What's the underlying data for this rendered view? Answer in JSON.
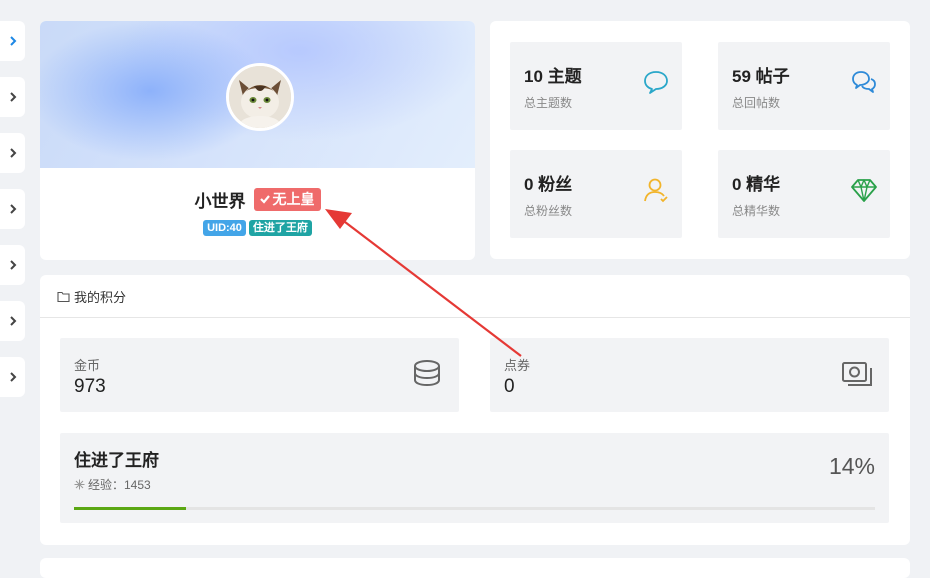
{
  "profile": {
    "username": "小世界",
    "rank": "无上皇",
    "uid_tag": "UID:40",
    "level_tag": "住进了王府"
  },
  "stats": [
    {
      "value": "10 主题",
      "label": "总主题数",
      "icon": "chat-bubble-icon",
      "color": "#2aa7c9"
    },
    {
      "value": "59 帖子",
      "label": "总回帖数",
      "icon": "chat-bubbles-icon",
      "color": "#2e8ad8"
    },
    {
      "value": "0 粉丝",
      "label": "总粉丝数",
      "icon": "user-icon",
      "color": "#f2b42a"
    },
    {
      "value": "0 精华",
      "label": "总精华数",
      "icon": "diamond-icon",
      "color": "#2aa14a"
    }
  ],
  "points": {
    "title": "我的积分",
    "gold": {
      "label": "金币",
      "value": "973"
    },
    "coupon": {
      "label": "点券",
      "value": "0"
    },
    "level": {
      "name": "住进了王府",
      "exp_label": "经验：1453",
      "percent_text": "14%",
      "progress": 0.14
    }
  },
  "colors": {
    "accent": "#43a5e8",
    "rank_badge": "#ef6b6b",
    "progress": "#5ba713",
    "annotation_arrow": "#e53935"
  }
}
